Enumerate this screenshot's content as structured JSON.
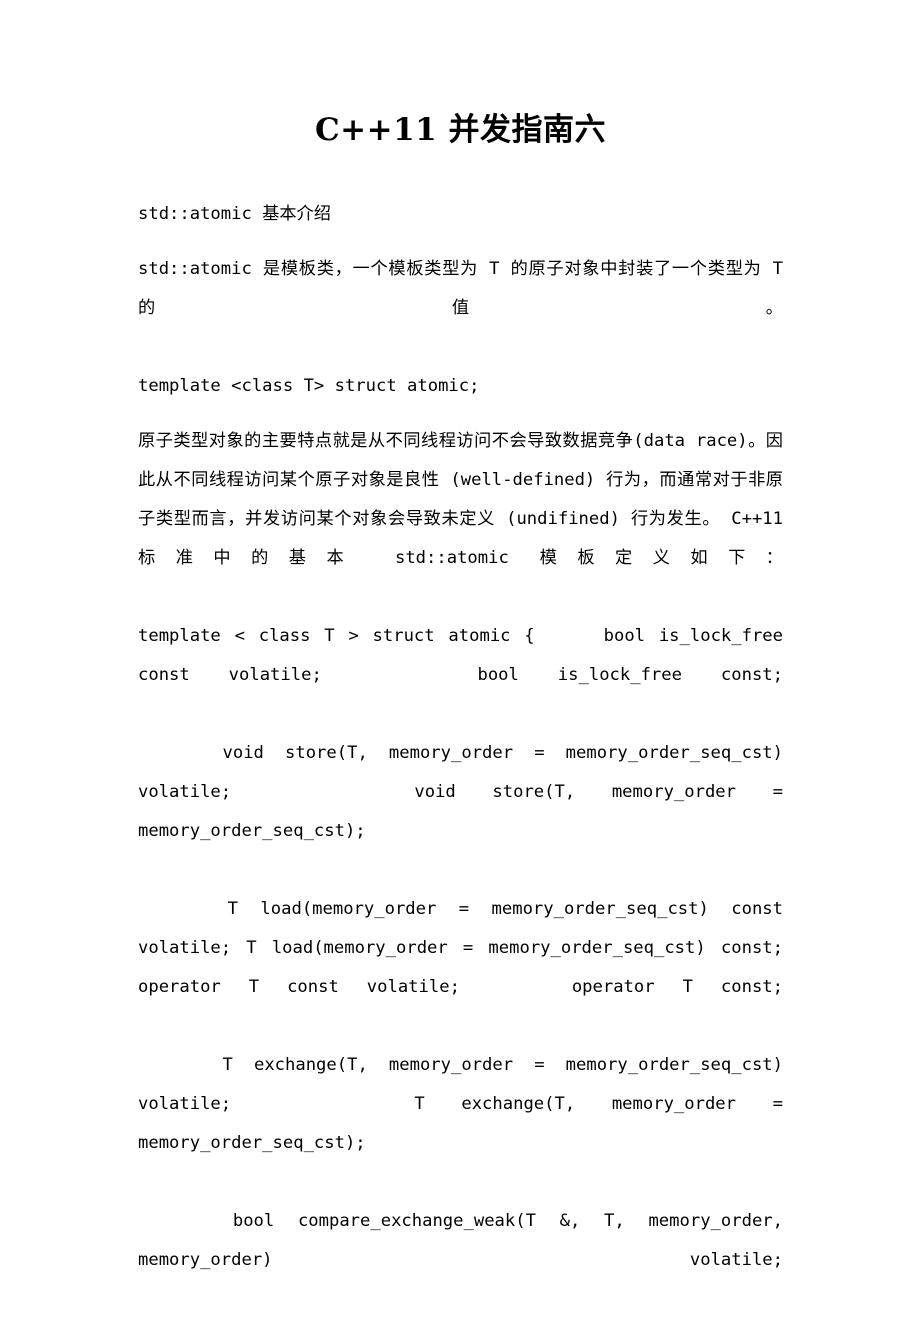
{
  "document": {
    "title": "C++11 并发指南六",
    "background_color": "#ffffff",
    "text_color": "#000000",
    "blocks": [
      {
        "id": "heading-section",
        "kind": "paragraph",
        "text": "std::atomic 基本介绍"
      },
      {
        "id": "intro-paragraph",
        "kind": "paragraph",
        "text": "std::atomic 是模板类，一个模板类型为 T 的原子对象中封装了一个类型为 T 的值。"
      },
      {
        "id": "template-decl",
        "kind": "code",
        "text": "template <class T> struct atomic;"
      },
      {
        "id": "atomic-description",
        "kind": "paragraph",
        "text": "原子类型对象的主要特点就是从不同线程访问不会导致数据竞争(data race)。因此从不同线程访问某个原子对象是良性 (well-defined) 行为，而通常对于非原子类型而言，并发访问某个对象会导致未定义 (undifined) 行为发生。 C++11 标准中的基本 std::atomic 模板定义如下："
      },
      {
        "id": "code-is-lock-free",
        "kind": "code",
        "text": "template < class T > struct atomic {     bool is_lock_free const volatile;    bool is_lock_free const;"
      },
      {
        "id": "code-store",
        "kind": "code",
        "text": "    void store(T, memory_order = memory_order_seq_cst) volatile;     void store(T, memory_order = memory_order_seq_cst);"
      },
      {
        "id": "code-load",
        "kind": "code",
        "text": "    T load(memory_order = memory_order_seq_cst) const volatile; T load(memory_order = memory_order_seq_cst) const;    operator T const volatile;    operator T const;"
      },
      {
        "id": "code-exchange",
        "kind": "code",
        "text": "    T exchange(T, memory_order = memory_order_seq_cst) volatile;     T exchange(T, memory_order = memory_order_seq_cst);"
      },
      {
        "id": "code-compare-exchange-weak",
        "kind": "code",
        "text": "    bool compare_exchange_weak(T &, T, memory_order, memory_order) volatile;"
      }
    ]
  }
}
